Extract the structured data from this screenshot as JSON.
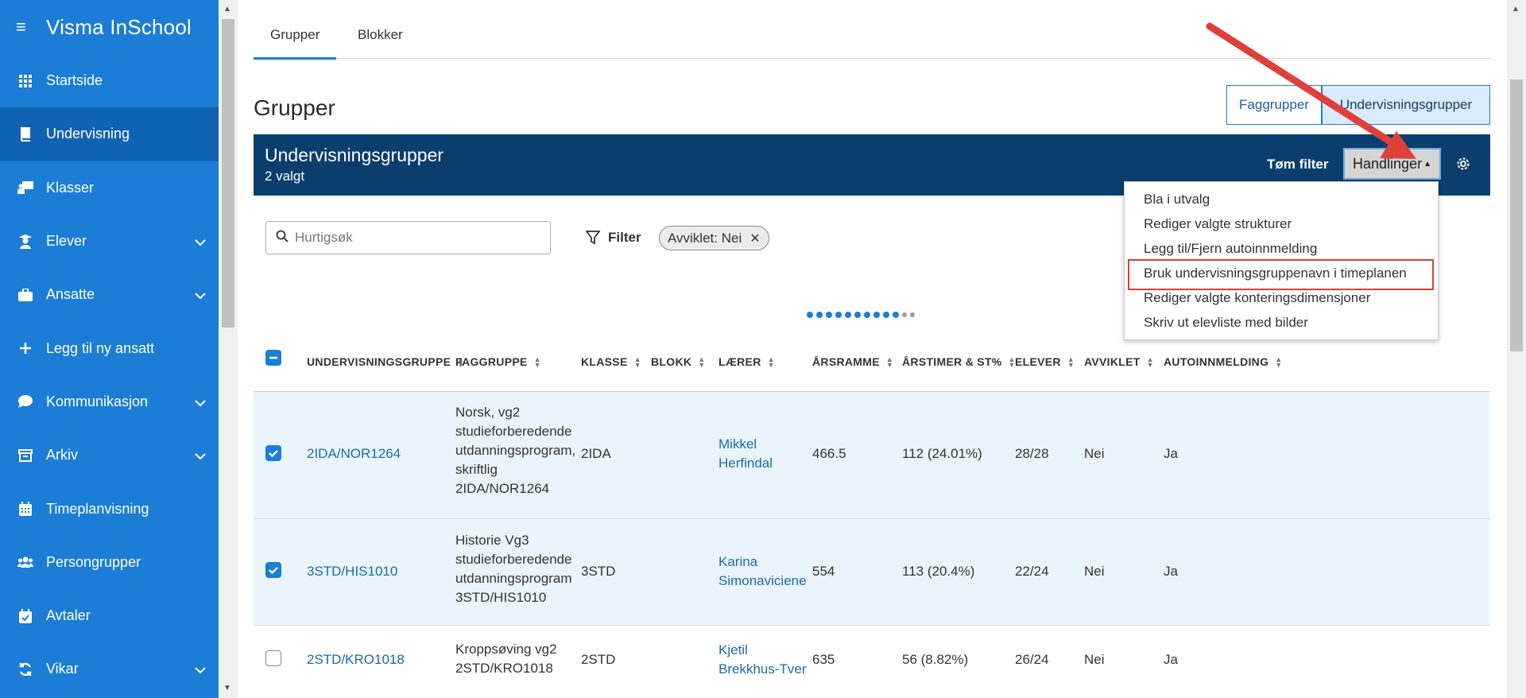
{
  "app": {
    "title": "Visma InSchool"
  },
  "sidebar": {
    "items": [
      {
        "label": "Startside",
        "icon": "grid-icon",
        "expandable": false
      },
      {
        "label": "Undervisning",
        "icon": "book-icon",
        "expandable": false,
        "active": true
      },
      {
        "label": "Klasser",
        "icon": "presentation-icon",
        "expandable": false
      },
      {
        "label": "Elever",
        "icon": "student-icon",
        "expandable": true
      },
      {
        "label": "Ansatte",
        "icon": "briefcase-icon",
        "expandable": true
      },
      {
        "label": "Legg til ny ansatt",
        "icon": "plus-icon",
        "expandable": false
      },
      {
        "label": "Kommunikasjon",
        "icon": "chat-icon",
        "expandable": true
      },
      {
        "label": "Arkiv",
        "icon": "archive-icon",
        "expandable": true
      },
      {
        "label": "Timeplanvisning",
        "icon": "calendar-icon",
        "expandable": false
      },
      {
        "label": "Persongrupper",
        "icon": "people-icon",
        "expandable": false
      },
      {
        "label": "Avtaler",
        "icon": "calendar-check-icon",
        "expandable": false
      },
      {
        "label": "Vikar",
        "icon": "swap-icon",
        "expandable": true
      }
    ]
  },
  "tabs": [
    {
      "label": "Grupper",
      "active": true
    },
    {
      "label": "Blokker",
      "active": false
    }
  ],
  "page": {
    "title": "Grupper"
  },
  "segment": {
    "option1": "Faggrupper",
    "option2": "Undervisningsgrupper"
  },
  "panel": {
    "title": "Undervisningsgrupper",
    "subtitle": "2 valgt",
    "clear_filter": "Tøm filter",
    "actions": "Handlinger"
  },
  "search": {
    "placeholder": "Hurtigsøk"
  },
  "filter": {
    "label": "Filter",
    "chip": "Avviklet: Nei"
  },
  "dropdown": {
    "items": [
      "Bla i utvalg",
      "Rediger valgte strukturer",
      "Legg til/Fjern autoinnmelding",
      "Bruk undervisningsgruppenavn i timeplanen",
      "Rediger valgte konteringsdimensjoner",
      "Skriv ut elevliste med bilder"
    ],
    "highlighted_index": 3
  },
  "table": {
    "columns": [
      "UNDERVISNINGSGRUPPE",
      "FAGGRUPPE",
      "KLASSE",
      "BLOKK",
      "LÆRER",
      "ÅRSRAMME",
      "ÅRSTIMER & ST%",
      "ELEVER",
      "AVVIKLET",
      "AUTOINNMELDING"
    ],
    "rows": [
      {
        "checked": true,
        "gruppe": "2IDA/NOR1264",
        "fag": [
          "Norsk, vg2",
          "studieforberedende",
          "utdanningsprogram,",
          "skriftlig",
          "2IDA/NOR1264"
        ],
        "klasse": "2IDA",
        "blokk": "",
        "laerer": [
          "Mikkel",
          "Herfindal"
        ],
        "arsramme": "466.5",
        "arstimer": "112 (24.01%)",
        "elever": "28/28",
        "avviklet": "Nei",
        "auto": "Ja"
      },
      {
        "checked": true,
        "gruppe": "3STD/HIS1010",
        "fag": [
          "Historie Vg3",
          "studieforberedende",
          "utdanningsprogram",
          "3STD/HIS1010"
        ],
        "klasse": "3STD",
        "blokk": "",
        "laerer": [
          "Karina",
          "Simonaviciene"
        ],
        "arsramme": "554",
        "arstimer": "113 (20.4%)",
        "elever": "22/24",
        "avviklet": "Nei",
        "auto": "Ja"
      },
      {
        "checked": false,
        "gruppe": "2STD/KRO1018",
        "fag": [
          "Kroppsøving vg2",
          "2STD/KRO1018"
        ],
        "klasse": "2STD",
        "blokk": "",
        "laerer": [
          "Kjetil",
          "Brekkhus-Tver"
        ],
        "arsramme": "635",
        "arstimer": "56 (8.82%)",
        "elever": "26/24",
        "avviklet": "Nei",
        "auto": "Ja"
      }
    ]
  },
  "colors": {
    "sidebar": "#1b7dd5",
    "sidebar_active": "#0f63b0",
    "panel_bar": "#0b3e6d",
    "link": "#1b6aaa",
    "annotation": "#d9403a"
  }
}
